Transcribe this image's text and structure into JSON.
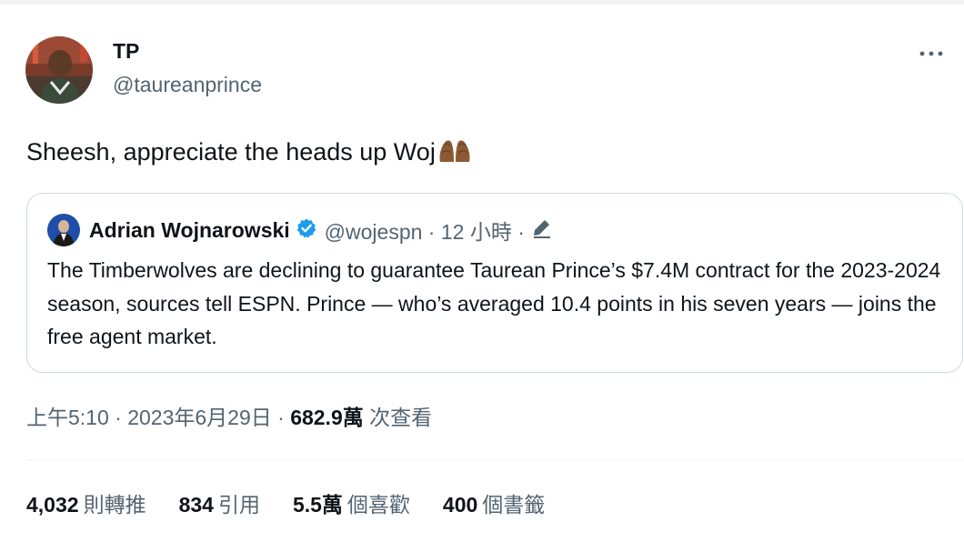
{
  "author": {
    "display_name": "TP",
    "handle": "@taureanprince"
  },
  "tweet": {
    "text": "Sheesh, appreciate the heads up Woj",
    "emoji": "folded-hands-medium-dark-skin"
  },
  "quoted_tweet": {
    "display_name": "Adrian Wojnarowski",
    "meta": "@wojespn · 12 小時 ·",
    "body": "The Timberwolves are declining to guarantee Taurean Prince’s $7.4M contract for the 2023-2024 season, sources tell ESPN. Prince — who’s averaged 10.4 points in his seven years — joins the free agent market."
  },
  "meta": {
    "timestamp": "上午5:10 · 2023年6月29日 · ",
    "views_count": "682.9萬",
    "views_label": "次查看"
  },
  "stats": {
    "retweets": {
      "count": "4,032",
      "label": "則轉推"
    },
    "quotes": {
      "count": "834",
      "label": "引用"
    },
    "likes": {
      "count": "5.5萬",
      "label": "個喜歡"
    },
    "bookmarks": {
      "count": "400",
      "label": "個書籤"
    }
  },
  "colors": {
    "text_primary": "#0f1419",
    "text_secondary": "#536471",
    "border": "#cfd9de",
    "verified_blue": "#1d9bf0"
  },
  "icons": {
    "more": "more-horizontal-icon",
    "verified": "verified-badge-icon",
    "edit": "edit-pencil-icon"
  }
}
